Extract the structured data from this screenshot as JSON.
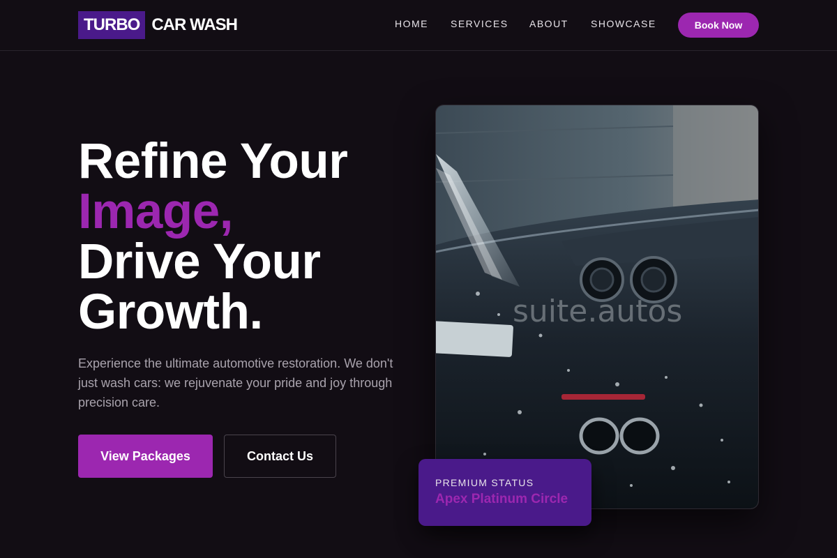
{
  "header": {
    "logo_box": "TURBO",
    "logo_text": "CAR WASH",
    "nav": [
      "HOME",
      "SERVICES",
      "ABOUT",
      "SHOWCASE"
    ],
    "cta": "Book Now"
  },
  "hero": {
    "headline": [
      "Refine Your",
      "Image,",
      "Drive Your",
      "Growth."
    ],
    "description": "Experience the ultimate automotive restoration. We don't just wash cars: we rejuvenate your pride and joy through precision care.",
    "primary_button": "View Packages",
    "secondary_button": "Contact Us"
  },
  "image": {
    "watermark": "suite.autos"
  },
  "badge": {
    "label": "PREMIUM STATUS",
    "value": "Apex Platinum Circle"
  },
  "colors": {
    "background": "#120d14",
    "accent": "#9c27b0",
    "brand_dark": "#4a1a8a",
    "muted_text": "#a9a3ad"
  }
}
